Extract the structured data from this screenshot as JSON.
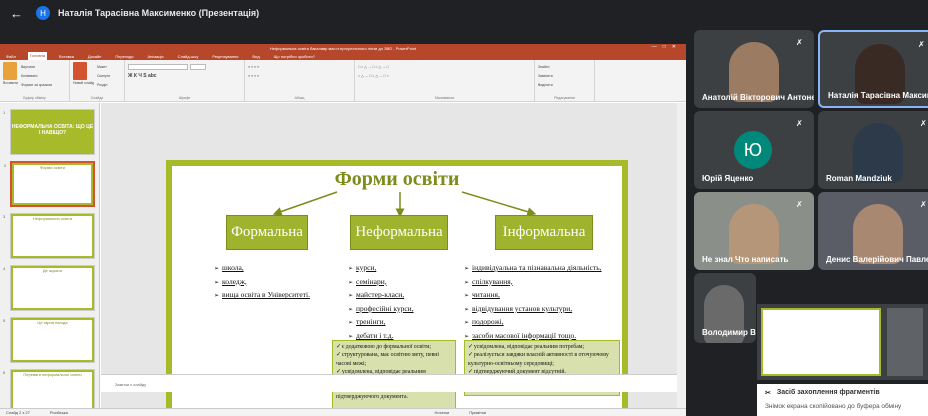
{
  "window": {
    "avatar_letter": "Н",
    "title": "Наталія Тарасівна Максименко (Презентація)"
  },
  "powerpoint": {
    "doc_title": "Неформальна освіта бакалавр маг.ст.прогрестиного лінзи до ЗВО - PowerPoint",
    "tabs": [
      "Файл",
      "Головна",
      "Вставка",
      "Дизайн",
      "Переходи",
      "Анімація",
      "Слайд-шоу",
      "Рецензування",
      "Вид",
      "Що потрібно зробити?"
    ],
    "active_tab": "Головна",
    "ribbon_groups": [
      "Буфер обміну",
      "Слайди",
      "Шрифт",
      "Абзац",
      "Малювання",
      "Редагування"
    ],
    "ribbon_items": {
      "paste": "Вставити",
      "cut": "Вирізати",
      "copy": "Копіювати",
      "format_painter": "Формат за зразком",
      "new_slide": "Новий слайд",
      "layout": "Макет",
      "reset": "Скинути",
      "section": "Розділ",
      "find": "Знайти",
      "replace": "Замінити",
      "select": "Виділити"
    },
    "status": {
      "slide": "Слайд 2 з 27",
      "lang": "Російська",
      "notes": "Нотатки",
      "comments": "Примітки"
    },
    "notes_placeholder": "Замітки к слайду",
    "thumb_numbers": [
      "1",
      "2",
      "3",
      "4",
      "5",
      "6"
    ],
    "thumb_titles": [
      "НЕФОРМАЛЬНА ОСВІТА: ЩО ЦЕ І НАВІЩО?",
      "Форми освіти",
      "Неформальна освіта",
      "Де шукати",
      "Це гарна нагода",
      "Переваги неформальної освіти"
    ]
  },
  "slide": {
    "title": "Форми освіти",
    "columns": [
      {
        "heading": "Формальна",
        "items": [
          "школа,",
          "коледж,",
          "вища освіта в Університеті."
        ]
      },
      {
        "heading": "Неформальна",
        "items": [
          "курси,",
          "семінари,",
          "майстер-класи,",
          "професійні курси,",
          "тренінги,",
          "дебати і т.д."
        ]
      },
      {
        "heading": "Інформальна",
        "items": [
          "індивідуальна та пізнавальна діяльність,",
          "спілкування,",
          "читання,",
          "відвідування установ культури,",
          "подорожі,",
          "засоби масової інформації тощо."
        ]
      }
    ],
    "notes_left": [
      "є додатковою до формальної освіти;",
      "структурована, має освітню мету, певні часові межі;",
      "усвідомлена, відповідає реальним потребам;",
      "зазвичай супроводжується видачею підтверджуючого документа."
    ],
    "notes_right": [
      "усвідомлена, відповідає реальним потребам;",
      "реалізується завдяки власній активності в оточуючому культурно-освітньому середовищі;",
      "підтверджуючий документ відсутній."
    ]
  },
  "participants": [
    {
      "name": "Анатолій Вікторович Антоне...",
      "type": "video"
    },
    {
      "name": "Наталія Тарасівна Максимен...",
      "type": "video"
    },
    {
      "name": "Юрій Яценко",
      "type": "avatar",
      "letter": "Ю"
    },
    {
      "name": "Roman Mandziuk",
      "type": "video"
    },
    {
      "name": "Не знал Что написать",
      "type": "video"
    },
    {
      "name": "Денис Валерійович Павленко",
      "type": "video"
    },
    {
      "name": "Володимир Вас...",
      "type": "video"
    }
  ],
  "toast": {
    "title": "Засіб захоплення фрагментів",
    "message": "Знімок екрана скопійовано до буфера обміну"
  },
  "colors": {
    "accent_green": "#a7ba2a",
    "box_green": "#9fb32e",
    "ppt_red": "#b7472a",
    "avatar_teal": "#00897b"
  }
}
